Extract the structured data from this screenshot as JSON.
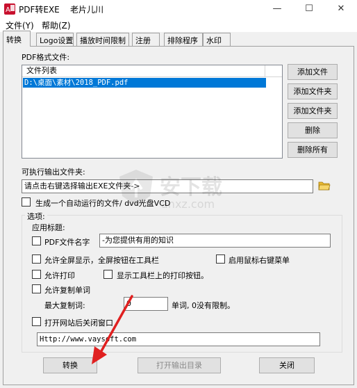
{
  "window": {
    "title": "PDF转EXE    老片儿川",
    "minimize": "—",
    "maximize": "☐",
    "close": "✕"
  },
  "menu": [
    "文件(Y)",
    "帮助(Z)"
  ],
  "tabs": [
    "转换",
    "Logo设置",
    "播放时间限制",
    "注册",
    "排除程序",
    "水印"
  ],
  "pdf_section": {
    "label": "PDF格式文件:",
    "list_header": "文件列表",
    "files": [
      "D:\\桌面\\素材\\2018_PDF.pdf"
    ]
  },
  "side_buttons": [
    "添加文件",
    "添加文件夹",
    "添加文件夹",
    "删除",
    "删除所有"
  ],
  "output": {
    "label": "可执行输出文件夹:",
    "placeholder": "请点击右键选择输出EXE文件夹->"
  },
  "autorun_label": "生成一个自动运行的文件/ dvd光盘VCD",
  "options": {
    "group_title": "选项:",
    "app_title_label": "应用标题:",
    "pdf_name_label": "PDF文件名字",
    "pdf_name_value": "-为您提供有用的知识",
    "fullscreen_label": "允许全屏显示，全屏按钮在工具栏",
    "right_click_label": "启用鼠标右键菜单",
    "print_label": "允许打印",
    "show_print_label": "显示工具栏上的打印按钮。",
    "copy_label": "允许复制单词",
    "max_copy_label": "最大复制词:",
    "max_copy_value": "0",
    "max_copy_hint": "单词, 0没有限制。",
    "open_site_label": "打开网站后关闭窗口",
    "url_value": "Http://www.vaysoft.com"
  },
  "bottom_buttons": {
    "convert": "转换",
    "open_output": "打开输出目录",
    "close": "关闭"
  },
  "watermark_text": "安下载",
  "watermark_sub": "anxz.com",
  "colors": {
    "selection": "#0078d7",
    "arrow": "#e02020"
  }
}
